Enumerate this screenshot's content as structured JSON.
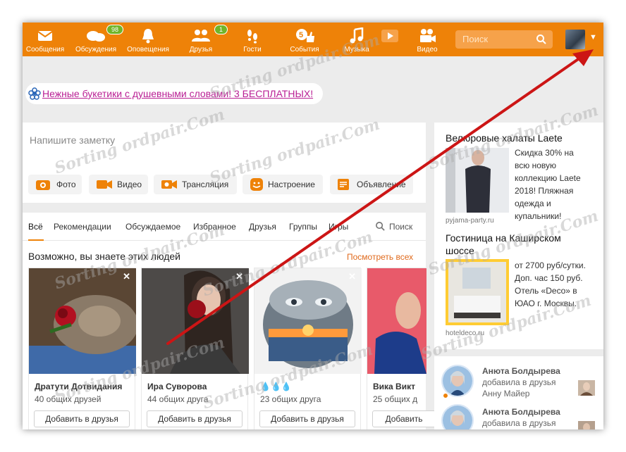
{
  "nav": {
    "items": [
      {
        "label": "Сообщения",
        "icon": "envelope-icon"
      },
      {
        "label": "Обсуждения",
        "icon": "chat-bubbles-icon",
        "badge": "98"
      },
      {
        "label": "Оповещения",
        "icon": "bell-icon"
      },
      {
        "label": "Друзья",
        "icon": "friends-icon",
        "badge": "1"
      },
      {
        "label": "Гости",
        "icon": "footprints-icon"
      },
      {
        "label": "События",
        "icon": "like-5-icon",
        "count": "5"
      },
      {
        "label": "Музыка",
        "icon": "music-note-icon"
      },
      {
        "label": "Видео",
        "icon": "video-camera-icon"
      }
    ],
    "search_placeholder": "Поиск",
    "caret": "▼"
  },
  "promo": {
    "text": "Нежные букетики с душевными словами! 3 БЕСПЛАТНЫХ!"
  },
  "note": {
    "placeholder": "Напишите заметку",
    "actions": [
      "Фото",
      "Видео",
      "Трансляция",
      "Настроение",
      "Объявление"
    ]
  },
  "feed": {
    "tabs": [
      "Всё",
      "Рекомендации",
      "Обсуждаемое",
      "Избранное",
      "Друзья",
      "Группы",
      "Игры"
    ],
    "search_label": "Поиск",
    "section_title": "Возможно, вы знаете этих людей",
    "see_all": "Посмотреть всех",
    "people": [
      {
        "name": "Дратути Дотвидания",
        "mutual": "40 общих друзей",
        "button": "Добавить в друзья"
      },
      {
        "name": "Ира Суворова",
        "mutual": "44 общих друга",
        "button": "Добавить в друзья"
      },
      {
        "name": "💧💧💧",
        "mutual": "23 общих друга",
        "button": "Добавить в друзья"
      },
      {
        "name": "Вика Викт",
        "mutual": "25 общих д",
        "button": "Добавить"
      }
    ]
  },
  "ads": [
    {
      "title": "Велюровые халаты Laete",
      "lines": [
        "Скидка 30% на",
        "всю новую",
        "коллекцию Laete",
        "2018! Пляжная",
        "одежда и",
        "купальники!"
      ],
      "source": "pyjama-party.ru"
    },
    {
      "title_lines": [
        "Гостиница на Каширском",
        "шоссе"
      ],
      "lines": [
        "от 2700 руб/сутки.",
        "Доп. час 150 руб.",
        "Отель «Deco» в",
        "ЮАО г. Москвы."
      ],
      "source": "hoteldeco.ru"
    }
  ],
  "activity": [
    {
      "name": "Анюта Болдырева",
      "line1": "добавила в друзья",
      "line2": "Анну Майер"
    },
    {
      "name": "Анюта Болдырева",
      "line1": "добавила в друзья",
      "line2": ""
    }
  ],
  "watermark": "Sorting ordpair.Com",
  "colors": {
    "brand_orange": "#ee8208",
    "promo_link": "#b91f94",
    "see_all": "#e06a1c",
    "badge_green": "#70b529",
    "arrow_red": "#cc1515"
  }
}
